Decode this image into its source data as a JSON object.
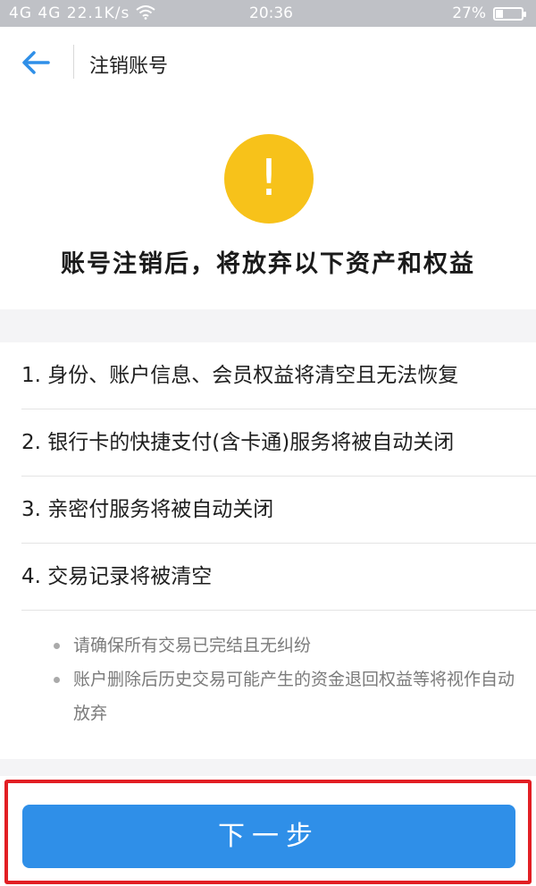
{
  "status_bar": {
    "signal": "4G 4G",
    "speed": "22.1K/s",
    "time": "20:36",
    "battery": "27%",
    "battery_level": 0.27,
    "icons": [
      "signal-icon",
      "wifi-icon",
      "battery-icon"
    ]
  },
  "nav": {
    "back_icon": "back-arrow-icon",
    "title": "注销账号"
  },
  "hero": {
    "icon": "warning-icon",
    "icon_glyph": "!",
    "icon_color": "#f7c21a",
    "title": "账号注销后，将放弃以下资产和权益"
  },
  "rights": [
    {
      "label": "1. 身份、账户信息、会员权益将清空且无法恢复"
    },
    {
      "label": "2. 银行卡的快捷支付(含卡通)服务将被自动关闭"
    },
    {
      "label": "3. 亲密付服务将被自动关闭"
    },
    {
      "label": "4. 交易记录将被清空"
    }
  ],
  "notes": [
    {
      "text": "请确保所有交易已完结且无纠纷"
    },
    {
      "text": "账户删除后历史交易可能产生的资金退回权益等将视作自动放弃"
    }
  ],
  "footer": {
    "next_label": "下一步",
    "button_color": "#2f8fe8",
    "highlight_color": "#e21e23"
  }
}
